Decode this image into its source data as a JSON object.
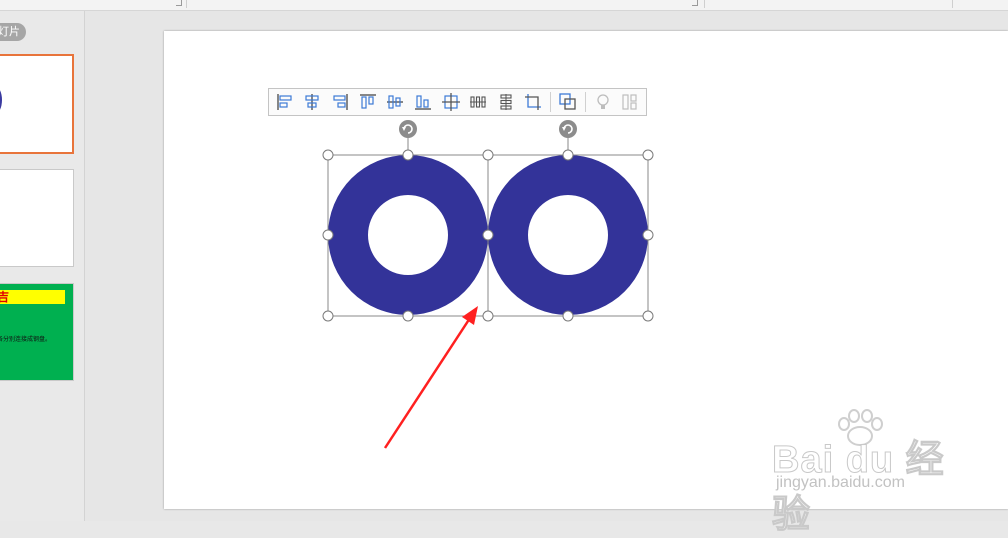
{
  "left_panel": {
    "slides_label": "灯片",
    "thumbs": [
      {
        "selected": true
      },
      {
        "selected": false
      },
      {
        "title": "吉",
        "body": "各分别连接成钢盘。"
      }
    ]
  },
  "toolbar": {
    "buttons": [
      {
        "name": "align-left-icon"
      },
      {
        "name": "align-center-icon"
      },
      {
        "name": "align-right-icon"
      },
      {
        "name": "align-top-icon"
      },
      {
        "name": "align-middle-icon"
      },
      {
        "name": "align-bottom-icon"
      },
      {
        "name": "align-center-both-icon"
      },
      {
        "name": "distribute-horizontal-icon"
      },
      {
        "name": "distribute-vertical-icon"
      },
      {
        "name": "crop-icon"
      },
      {
        "name": "group-icon"
      },
      {
        "name": "bulb-icon"
      },
      {
        "name": "more-icon"
      }
    ]
  },
  "shapes": {
    "ring_color": "#333399",
    "arrow_color": "#ff2020",
    "count": 2
  },
  "watermark": {
    "line1": "Bai du 经验",
    "line2": "jingyan.baidu.com"
  }
}
